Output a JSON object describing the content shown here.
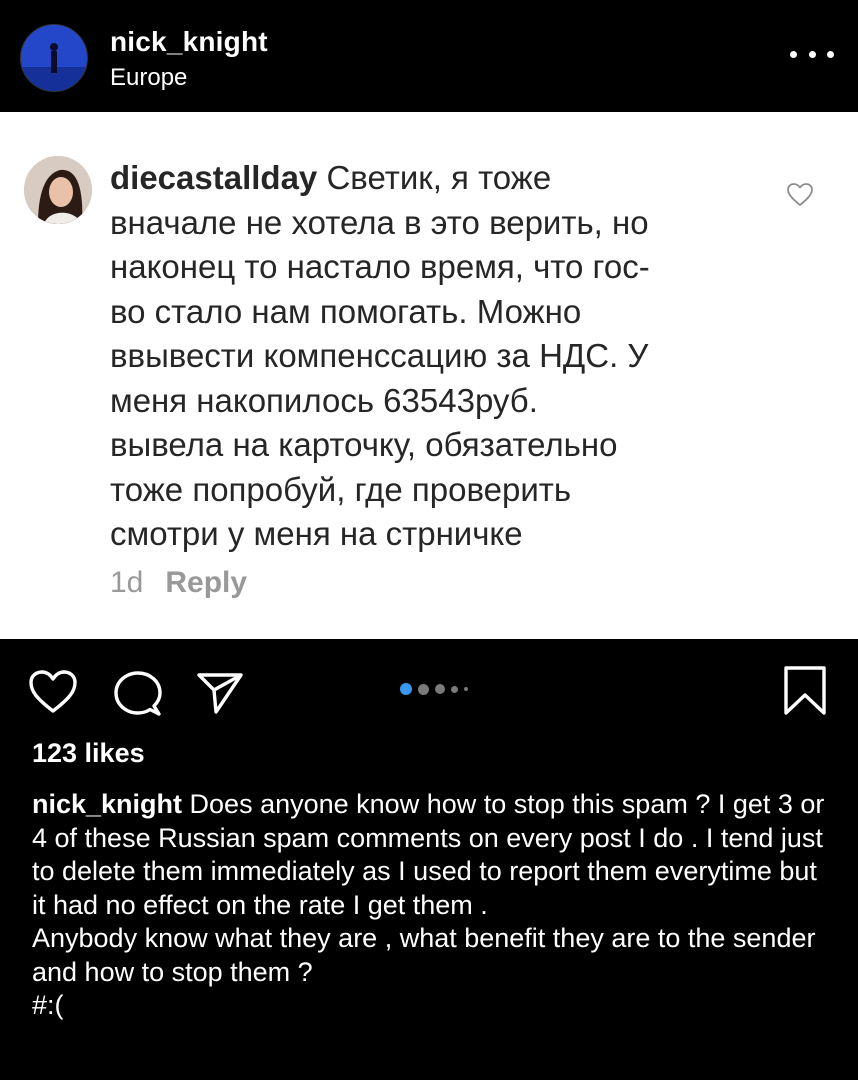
{
  "post_header": {
    "username": "nick_knight",
    "location": "Europe",
    "more_icon": "more-horizontal-icon"
  },
  "comment_screenshot": {
    "username": "diecastallday",
    "text_lines": [
      "Светик, я тоже",
      "вначале не хотела в это верить, но",
      "наконец то настало время, что гос-",
      "во стало нам помогать. Можно",
      "ввывести компенссацию за НДС. У",
      "меня накопилось 63543руб.",
      "вывела на карточку, обязательно",
      "тоже попробуй, где проверить",
      "смотри у меня на стрничке"
    ],
    "time": "1d",
    "reply_label": "Reply",
    "heart_icon": "heart-outline-icon"
  },
  "actions": {
    "icons": [
      "heart-icon",
      "comment-icon",
      "share-icon",
      "bookmark-icon"
    ],
    "carousel_dots": 5,
    "active_dot": 0,
    "active_color": "#3897f0"
  },
  "likes_text": "123 likes",
  "caption": {
    "username": "nick_knight",
    "line1": "Does anyone know how to stop this spam ? I get 3 or 4 of these Russian spam comments on every post I do .  I tend just to delete them immediately as I used to report them everytime but it had no effect on the rate I get them .",
    "line2": "Anybody know what they are , what benefit they are to the sender and how to stop them ?",
    "line3": "#:("
  }
}
